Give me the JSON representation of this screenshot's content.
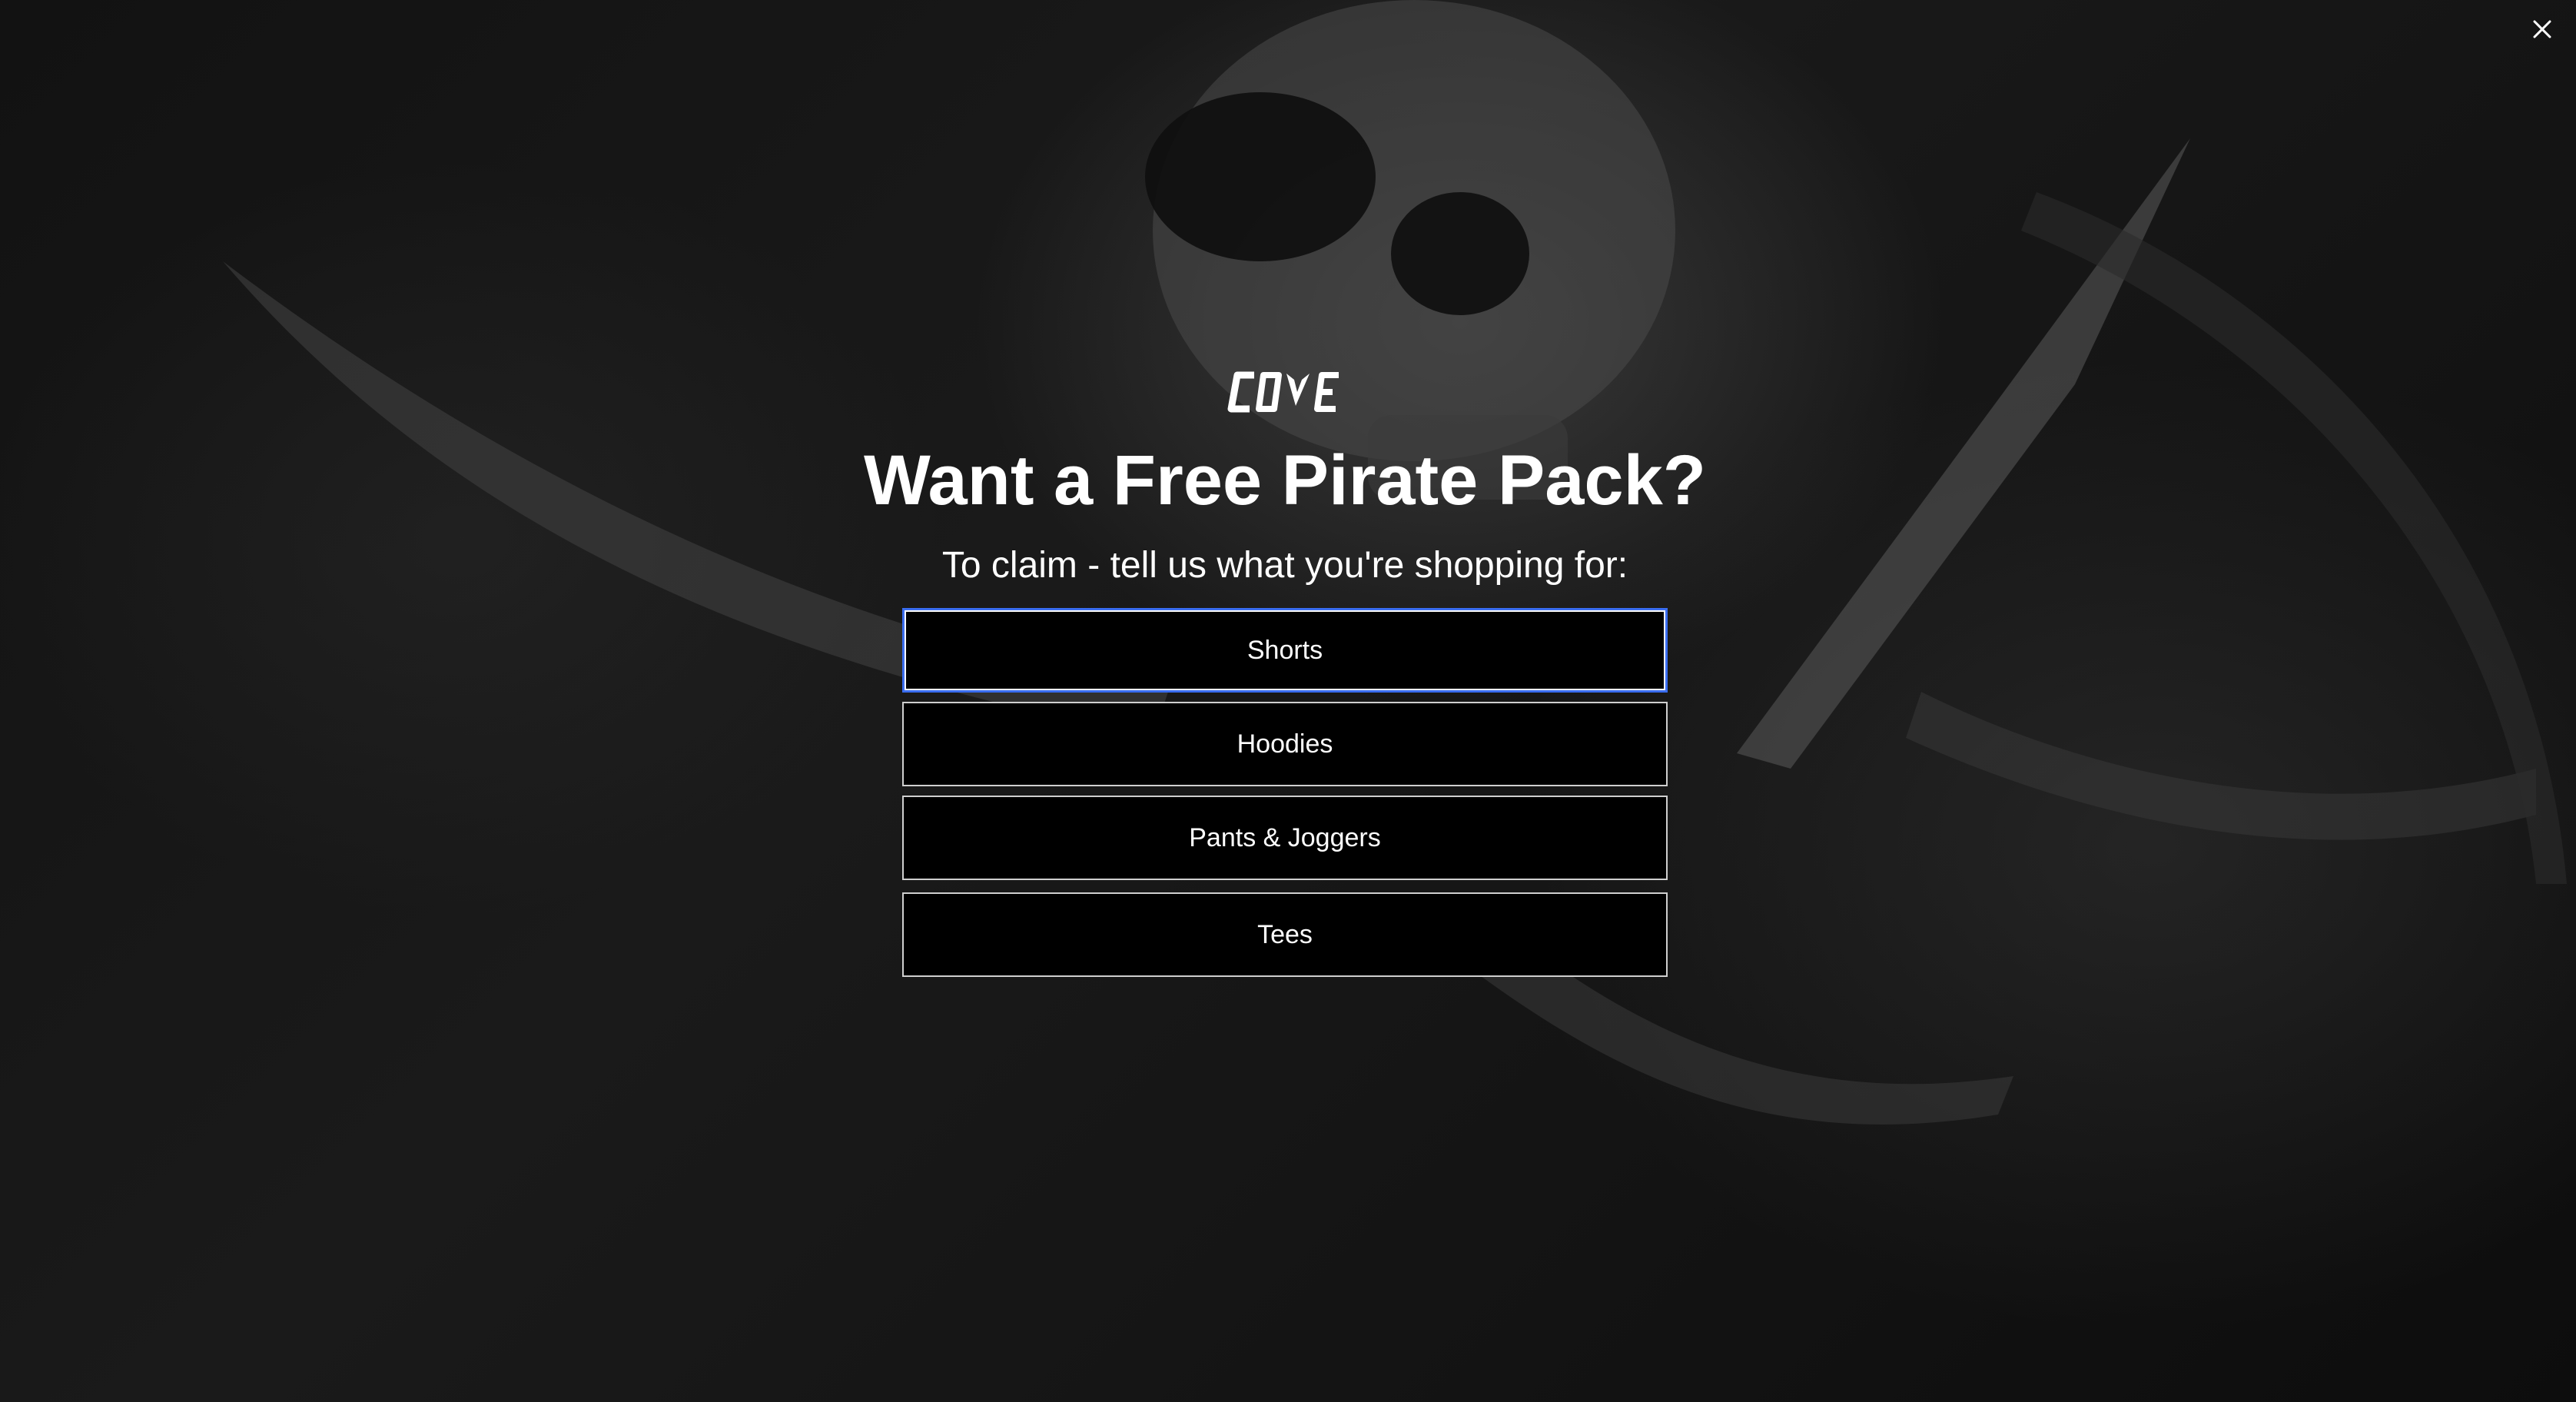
{
  "brand": {
    "logo_text": "COVE"
  },
  "popup": {
    "headline": "Want a Free Pirate Pack?",
    "subheadline": "To claim - tell us what you're shopping for:",
    "options": [
      {
        "label": "Shorts",
        "focused": true
      },
      {
        "label": "Hoodies",
        "focused": false
      },
      {
        "label": "Pants & Joggers",
        "focused": false
      },
      {
        "label": "Tees",
        "focused": false
      }
    ]
  },
  "icons": {
    "close": "close-icon"
  },
  "colors": {
    "background": "#0b0b0b",
    "text": "#ffffff",
    "button_bg": "#000000",
    "focus_ring": "#3a6df0"
  }
}
